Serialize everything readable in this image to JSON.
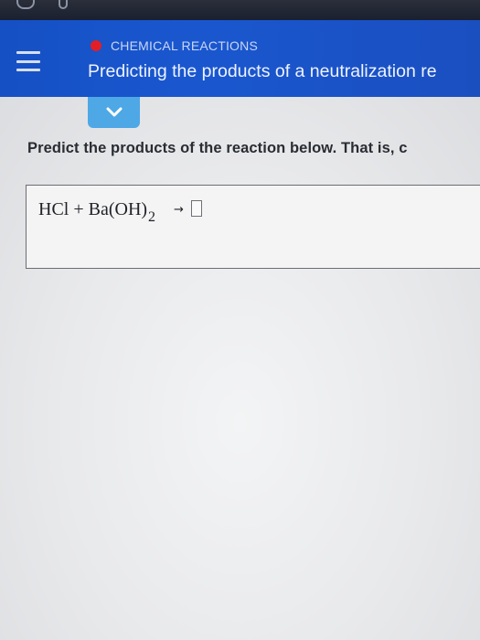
{
  "header": {
    "category": "CHEMICAL REACTIONS",
    "title": "Predicting the products of a neutralization re"
  },
  "question": {
    "prompt": "Predict the products of the reaction below. That is, c",
    "equation": {
      "reactants": "HCl + Ba(OH)",
      "subscript": "2",
      "arrow": "→"
    }
  },
  "colors": {
    "header_blue": "#1a57cf",
    "status_dot": "#e21f26",
    "expand_tab": "#4ea8e6"
  },
  "icons": [
    "menu-icon",
    "status-dot-icon",
    "chevron-down-icon"
  ]
}
